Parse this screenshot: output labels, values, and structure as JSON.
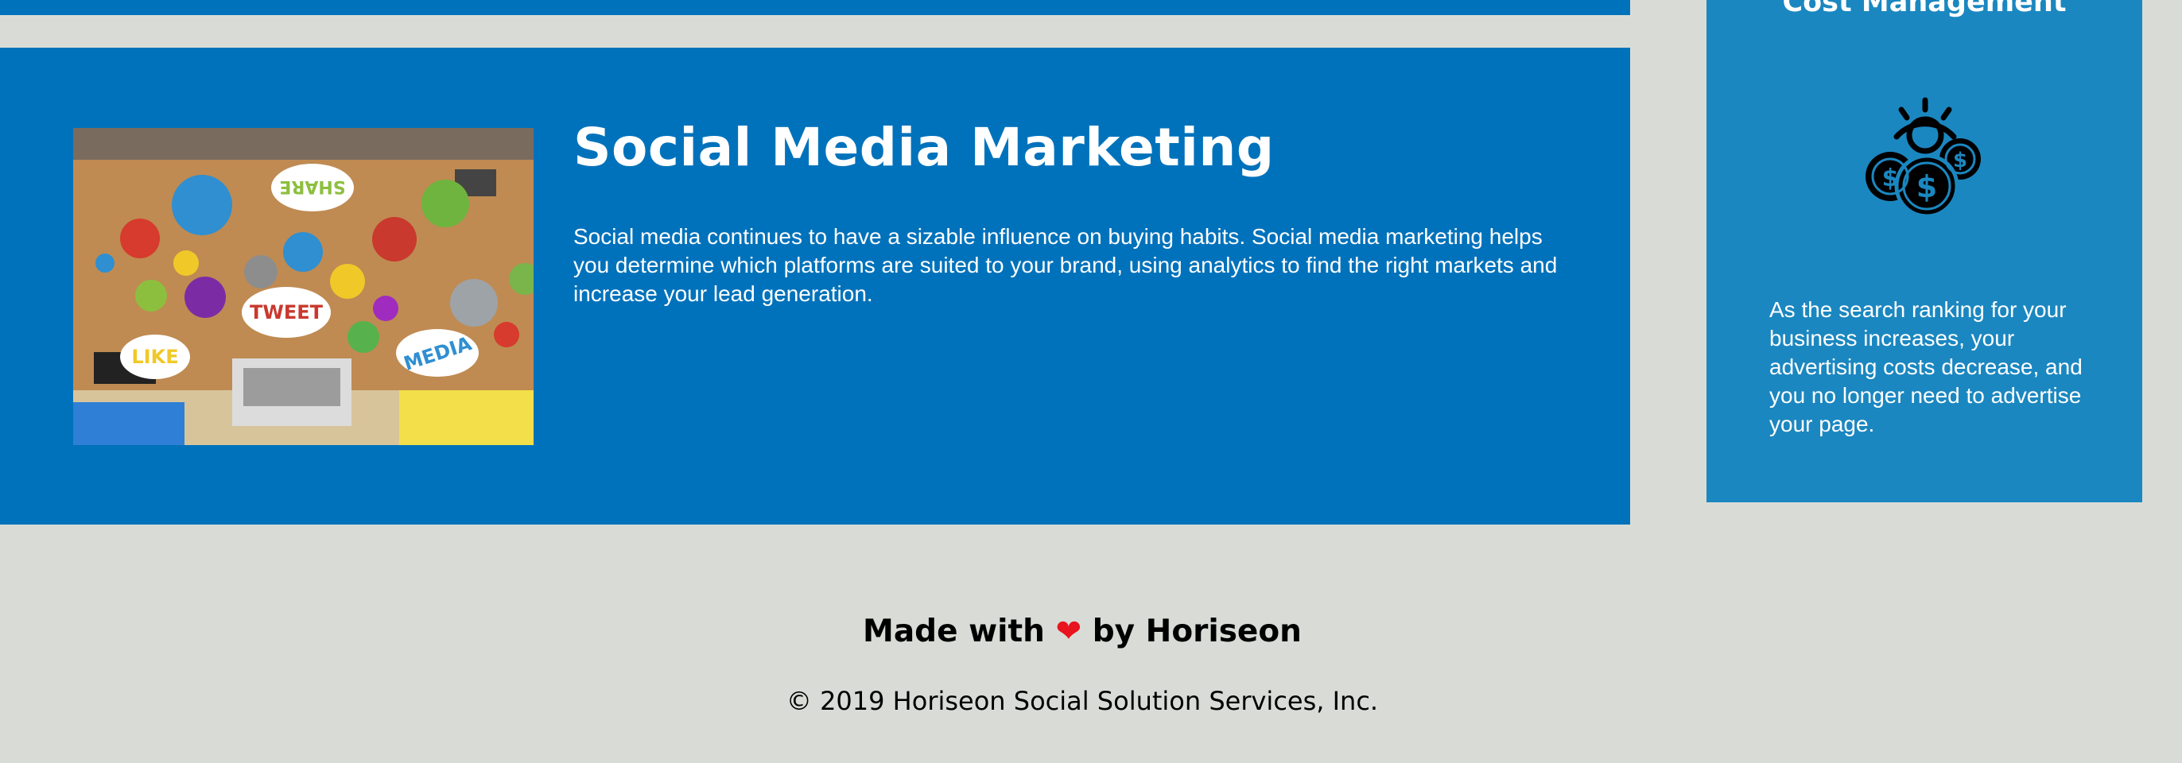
{
  "section": {
    "title": "Social Media Marketing",
    "text": "Social media continues to have a sizable influence on buying habits. Social media marketing helps you determine which platforms are suited to your brand, using analytics to find the right markets and increase your lead generation.",
    "image_words": [
      "SHARE",
      "TWEET",
      "LIKE",
      "MEDIA"
    ]
  },
  "sidebar": {
    "title": "Cost Management",
    "icon": "cost-management-icon",
    "text": "As the search ranking for your business increases, your advertising costs decrease, and you no longer need to advertise your page."
  },
  "footer": {
    "made_prefix": "Made with",
    "heart": "❤",
    "made_suffix": "by Horiseon",
    "copyright": "© 2019 Horiseon Social Solution Services, Inc."
  },
  "colors": {
    "section_bg": "#0072bb",
    "sidebar_bg": "#1b87c0",
    "page_bg": "#d9dcd6",
    "heart": "#e8141e"
  }
}
